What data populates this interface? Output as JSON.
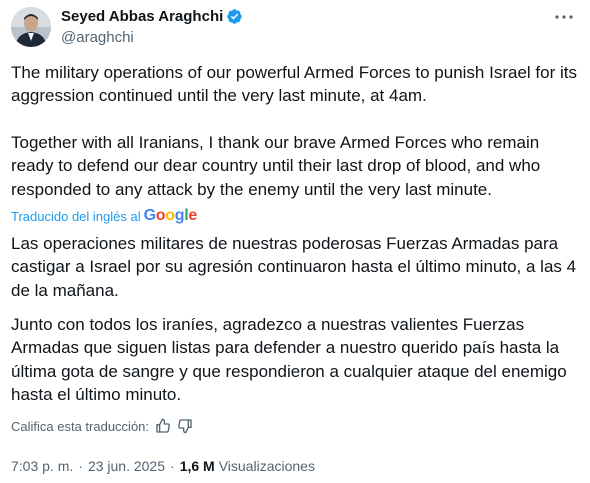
{
  "author": {
    "name": "Seyed Abbas Araghchi",
    "handle": "@araghchi",
    "verified": true
  },
  "tweet": {
    "original_paragraphs": [
      "The military operations of our powerful Armed Forces to punish Israel for its aggression continued until the very last minute, at 4am.",
      "Together with all Iranians, I thank our brave Armed Forces who remain ready to defend our dear country until their last drop of blood, and who responded to any attack by the enemy until the very last minute."
    ],
    "translated_by_label": "Traducido del inglés al",
    "translation_provider": "Google",
    "translated_paragraphs": [
      "Las operaciones militares de nuestras poderosas Fuerzas Armadas para castigar a Israel por su agresión continuaron hasta el último minuto, a las 4 de la mañana.",
      "Junto con todos los iraníes, agradezco a nuestras valientes Fuerzas Armadas que siguen listas para defender a nuestro querido país hasta la última gota de sangre y que respondieron a cualquier ataque del enemigo hasta el último minuto."
    ],
    "rate_translation_label": "Califica esta traducción:",
    "time": "7:03 p. m.",
    "separator": "·",
    "date": "23 jun. 2025",
    "views_count": "1,6 M",
    "views_label": "Visualizaciones"
  },
  "colors": {
    "accent": "#1d9bf0",
    "secondary_text": "#536471",
    "primary_text": "#0f1419"
  },
  "icons": [
    "avatar",
    "verified-badge-icon",
    "more-options-icon",
    "google-logo",
    "thumbs-up-icon",
    "thumbs-down-icon"
  ]
}
